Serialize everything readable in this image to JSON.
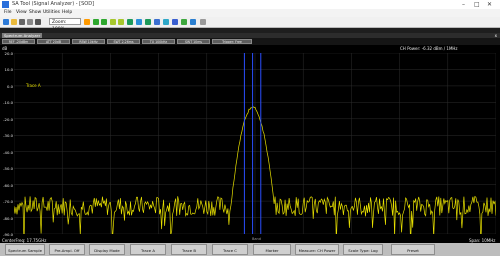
{
  "window": {
    "title": "SA Tool (Signal Analyzer) - [SOD]",
    "minimize": "–",
    "maximize": "□",
    "close": "✕"
  },
  "menu": [
    "File",
    "View",
    "Show",
    "Utilities",
    "Help"
  ],
  "toolbar": {
    "zoom_value": "Zoom: 100%"
  },
  "panel": {
    "tab_label": "Spectrum Analyzer",
    "close_glyph": "x"
  },
  "softkeys": [
    "REF -20dBm",
    "ATT 20dB",
    "RBW 10kHz",
    "SWT 2.26ms",
    "TX 100kHz",
    "SWT 10ms",
    "Trigger: Free"
  ],
  "screen": {
    "unit": "dB",
    "ch_power": "CH Power: -6.32 dBm / 1MHz",
    "trace_label": "Trace A",
    "center_freq": "CenterFreq: 17.75GHz",
    "span": "Span: 10MHz",
    "marker_label": "Band"
  },
  "bottom_keys": [
    "Spectrum Sample",
    "Pre-Ampl. Off",
    "Display Mode",
    "Trace A",
    "Trace B",
    "Trace C",
    "Marker",
    "Measure: CH Power",
    "Scale Type: Log",
    "Preset"
  ],
  "colors": {
    "trace": "#e7e000",
    "band_lines": "#2a4fff",
    "grid": "#2d2d2d",
    "screen_bg": "#000000"
  },
  "chart_data": {
    "type": "line",
    "x_range": [
      0,
      1
    ],
    "ylim": [
      -90,
      20
    ],
    "y_ticks": [
      "20.0",
      "10.0",
      "0.0",
      "-10.0",
      "-20.0",
      "-30.0",
      "-40.0",
      "-50.0",
      "-60.0",
      "-70.0",
      "-80.0",
      "-90.0"
    ],
    "noise_floor_db": -73,
    "noise_spread_db": 6,
    "peak_db": -13,
    "peak_position": 0.495,
    "peak_halfwidth": 0.045,
    "band_marker_positions": [
      0.478,
      0.495,
      0.512
    ]
  }
}
